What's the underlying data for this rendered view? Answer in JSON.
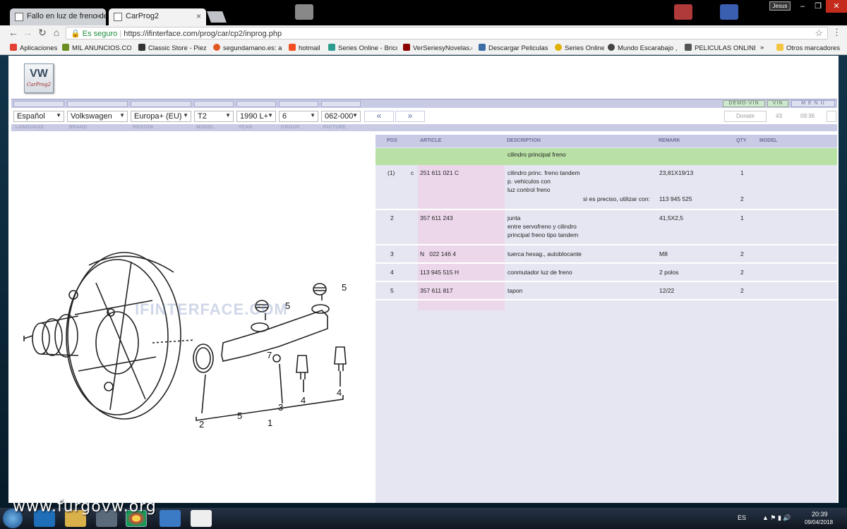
{
  "browser": {
    "tabs": [
      {
        "label": "Fallo en luz de freno de •",
        "active": false
      },
      {
        "label": "CarProg2",
        "active": true
      }
    ],
    "window_user": "Jesus",
    "address": {
      "secure_label": "Es seguro",
      "url": "https://ifinterface.com/prog/car/cp2/inprog.php"
    },
    "bookmarks": [
      {
        "label": "Aplicaciones",
        "color": "#e34133"
      },
      {
        "label": "MIL ANUNCIOS.COM",
        "color": "#6b8e23"
      },
      {
        "label": "Classic Store - Piezas",
        "color": "#333333"
      },
      {
        "label": "segundamano.es: anu",
        "color": "#e25822"
      },
      {
        "label": "hotmail",
        "color": "#f25022"
      },
      {
        "label": "Series Online - Brico",
        "color": "#2a9d8f"
      },
      {
        "label": "VerSeriesyNovelas.co",
        "color": "#8b0000"
      },
      {
        "label": "Descargar Peliculas G",
        "color": "#3a6ea5"
      },
      {
        "label": "Series Online",
        "color": "#e0b000"
      },
      {
        "label": "Mundo Escarabajo , S",
        "color": "#444444"
      },
      {
        "label": "PELICULAS ONLINE N",
        "color": "#555555"
      },
      {
        "label": "»",
        "color": ""
      },
      {
        "label": "Otros marcadores",
        "color": "#f4c542"
      }
    ]
  },
  "app": {
    "logo_text": "VW",
    "logo_sub": "CarProg2",
    "header_buttons": [
      "DEMO-VIN",
      "VIN",
      "M E N U"
    ],
    "selectors": [
      {
        "name": "language",
        "value": "Español"
      },
      {
        "name": "brand",
        "value": "Volkswagen"
      },
      {
        "name": "region",
        "value": "Europa+ (EU)"
      },
      {
        "name": "model",
        "value": "T2"
      },
      {
        "name": "year",
        "value": "1990  L+"
      },
      {
        "name": "group",
        "value": "6"
      },
      {
        "name": "picture",
        "value": "062-000"
      }
    ],
    "nav_prev": "«",
    "nav_next": "»",
    "donate_label": "Donate",
    "count": "43",
    "clock": "09:36",
    "selector_labels": [
      "LANGUAGE",
      "BRAND",
      "REGION",
      "MODEL",
      "YEAR",
      "GROUP",
      "PICTURE"
    ]
  },
  "parts": {
    "headers": {
      "pos": "POS",
      "article": "ARTICLE",
      "description": "DESCRIPTION",
      "remark": "REMARK",
      "qty": "QTY",
      "model": "MODEL"
    },
    "group_title": "cilindro principal freno",
    "rows": [
      {
        "pos": "(1)",
        "flag": "c",
        "article": "251 611 021 C",
        "description": [
          "cilindro princ. freno tandem",
          "p. vehiculos con",
          "luz control freno"
        ],
        "remark": "23,81X19/13",
        "qty": "1",
        "note": "si es preciso, utilizar con:",
        "note_article": "113 945 525",
        "note_qty": "2"
      },
      {
        "pos": "2",
        "flag": "",
        "article": "357 611 243",
        "description": [
          "junta",
          "entre servofreno y cilindro",
          "principal freno tipo tandem"
        ],
        "remark": "41,5X2,5",
        "qty": "1"
      },
      {
        "pos": "3",
        "flag": "",
        "article": "N   022 146 4",
        "description": [
          "tuerca hexag., autoblocante"
        ],
        "remark": "M8",
        "qty": "2"
      },
      {
        "pos": "4",
        "flag": "",
        "article": "113 945 515 H",
        "description": [
          "conmutador luz de freno"
        ],
        "remark": "2 polos",
        "qty": "2"
      },
      {
        "pos": "5",
        "flag": "",
        "article": "357 611 817",
        "description": [
          "tapon"
        ],
        "remark": "12/22",
        "qty": "2"
      }
    ]
  },
  "diagram": {
    "watermark": "IFINTERFACE.COM",
    "callouts": [
      "5",
      "5",
      "7",
      "2",
      "5",
      "1",
      "3",
      "4",
      "4"
    ]
  },
  "taskbar": {
    "overlay_text": "www.furgovw.org",
    "lang": "ES",
    "time": "20:39",
    "date": "09/04/2018"
  }
}
